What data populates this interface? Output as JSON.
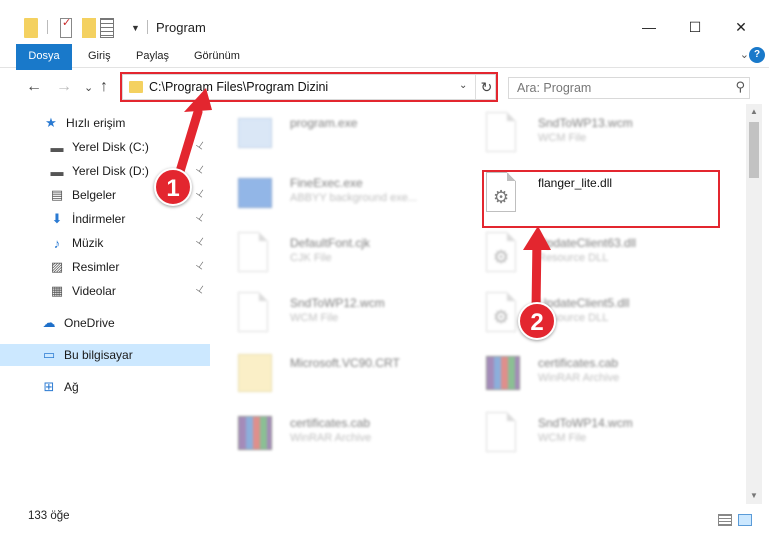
{
  "window": {
    "title": "Program",
    "minimize_glyph": "—",
    "maximize_glyph": "☐",
    "close_glyph": "✕"
  },
  "ribbon": {
    "tabs": [
      "Dosya",
      "Giriş",
      "Paylaş",
      "Görünüm"
    ],
    "help_glyph": "?",
    "expand_glyph": "⌄"
  },
  "navigation": {
    "back_glyph": "←",
    "forward_glyph": "→",
    "recent_glyph": "⌄",
    "up_glyph": "↑",
    "address": "C:\\Program Files\\Program Dizini",
    "address_dropdown_glyph": "⌄",
    "refresh_glyph": "↻",
    "search_placeholder": "Ara: Program",
    "search_glyph": "⚲"
  },
  "sidebar": {
    "items": [
      {
        "label": "Hızlı erişim",
        "icon": "star-icon",
        "glyph": "★",
        "color": "#2a7ad2"
      },
      {
        "label": "Yerel Disk (C:)",
        "icon": "drive-icon",
        "glyph": "▬",
        "color": "#555555",
        "pinned": true
      },
      {
        "label": "Yerel Disk (D:)",
        "icon": "drive-icon",
        "glyph": "▬",
        "color": "#555555",
        "pinned": true
      },
      {
        "label": "Belgeler",
        "icon": "documents-icon",
        "glyph": "▤",
        "color": "#555555",
        "pinned": true
      },
      {
        "label": "İndirmeler",
        "icon": "download-icon",
        "glyph": "⬇",
        "color": "#2a7ad2",
        "pinned": true
      },
      {
        "label": "Müzik",
        "icon": "music-icon",
        "glyph": "♪",
        "color": "#2a7ad2",
        "pinned": true
      },
      {
        "label": "Resimler",
        "icon": "pictures-icon",
        "glyph": "▨",
        "color": "#555555",
        "pinned": true
      },
      {
        "label": "Videolar",
        "icon": "video-icon",
        "glyph": "▦",
        "color": "#555555",
        "pinned": true
      },
      {
        "label": "OneDrive",
        "icon": "cloud-icon",
        "glyph": "☁",
        "color": "#1e6fc9"
      },
      {
        "label": "Bu bilgisayar",
        "icon": "computer-icon",
        "glyph": "▭",
        "color": "#2a7ad2",
        "selected": true
      },
      {
        "label": "Ağ",
        "icon": "network-icon",
        "glyph": "⊞",
        "color": "#2a7ad2"
      }
    ],
    "pin_glyph": "📌"
  },
  "files": [
    {
      "name": "program.exe",
      "type": "",
      "icon": "exe-light"
    },
    {
      "name": "SndToWP13.wcm",
      "type": "WCM File",
      "icon": "doc"
    },
    {
      "name": "FineExec.exe",
      "type": "ABBYY background exe...",
      "icon": "exe"
    },
    {
      "name": "flanger_lite.dll",
      "type": "",
      "icon": "dll",
      "highlighted": true
    },
    {
      "name": "DefaultFont.cjk",
      "type": "CJK File",
      "icon": "doc"
    },
    {
      "name": "UpdateClient63.dll",
      "type": "Resource DLL",
      "icon": "dll"
    },
    {
      "name": "SndToWP12.wcm",
      "type": "WCM File",
      "icon": "doc"
    },
    {
      "name": "UpdateClient5.dll",
      "type": "Resource DLL",
      "icon": "dll"
    },
    {
      "name": "Microsoft.VC90.CRT",
      "type": "",
      "icon": "vcfolder"
    },
    {
      "name": "certificates.cab",
      "type": "WinRAR Archive",
      "icon": "cab"
    },
    {
      "name": "certificates.cab",
      "type": "WinRAR Archive",
      "icon": "cab"
    },
    {
      "name": "SndToWP14.wcm",
      "type": "WCM File",
      "icon": "doc"
    }
  ],
  "status": {
    "item_count": "133 öğe"
  },
  "callouts": [
    {
      "number": "1"
    },
    {
      "number": "2"
    }
  ],
  "colors": {
    "accent": "#1979ca",
    "callout_red": "#e3262f",
    "selection": "#cce8ff"
  }
}
